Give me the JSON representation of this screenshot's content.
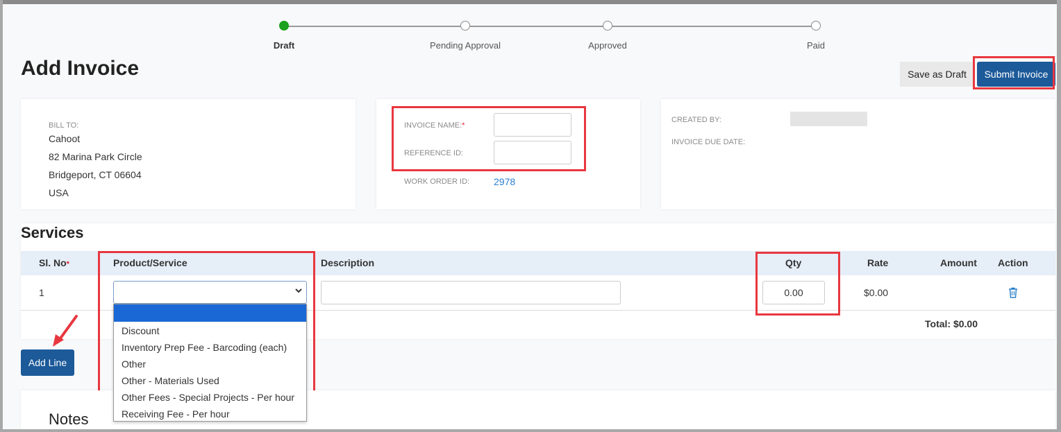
{
  "stepper": {
    "steps": [
      {
        "label": "Draft",
        "active": true
      },
      {
        "label": "Pending Approval",
        "active": false
      },
      {
        "label": "Approved",
        "active": false
      },
      {
        "label": "Paid",
        "active": false
      }
    ],
    "active_color": "#1ca21c"
  },
  "page_title": "Add Invoice",
  "actions": {
    "save_draft_label": "Save as Draft",
    "submit_label": "Submit Invoice"
  },
  "bill_to": {
    "label": "BILL TO:",
    "name": "Cahoot",
    "address_line1": "82 Marina Park Circle",
    "address_line2": "Bridgeport, CT 06604",
    "country": "USA"
  },
  "invoice_info": {
    "invoice_name_label": "INVOICE NAME:",
    "required_mark": "*",
    "invoice_name_value": "",
    "reference_id_label": "REFERENCE ID:",
    "reference_id_value": "",
    "work_order_label": "WORK ORDER ID:",
    "work_order_value": "2978"
  },
  "meta": {
    "created_by_label": "CREATED BY:",
    "due_date_label": "INVOICE DUE DATE:"
  },
  "services": {
    "title": "Services",
    "columns": {
      "sl_no": "Sl. No",
      "product": "Product/Service",
      "description": "Description",
      "qty": "Qty",
      "rate": "Rate",
      "amount": "Amount",
      "action": "Action"
    },
    "rows": [
      {
        "sl_no": "1",
        "product": "",
        "description": "",
        "qty": "0.00",
        "rate": "$0.00",
        "amount": ""
      }
    ],
    "total": "Total: $0.00"
  },
  "product_options": [
    "",
    "Discount",
    "Inventory Prep Fee - Barcoding (each)",
    "Other",
    "Other - Materials Used",
    "Other Fees - Special Projects - Per hour",
    "Receiving Fee - Per hour"
  ],
  "add_line_label": "Add Line",
  "notes_title": "Notes",
  "colors": {
    "primary": "#1c5a99",
    "annotation": "#e8373f",
    "highlight": "#1a68d6",
    "link": "#2a7ec9"
  }
}
